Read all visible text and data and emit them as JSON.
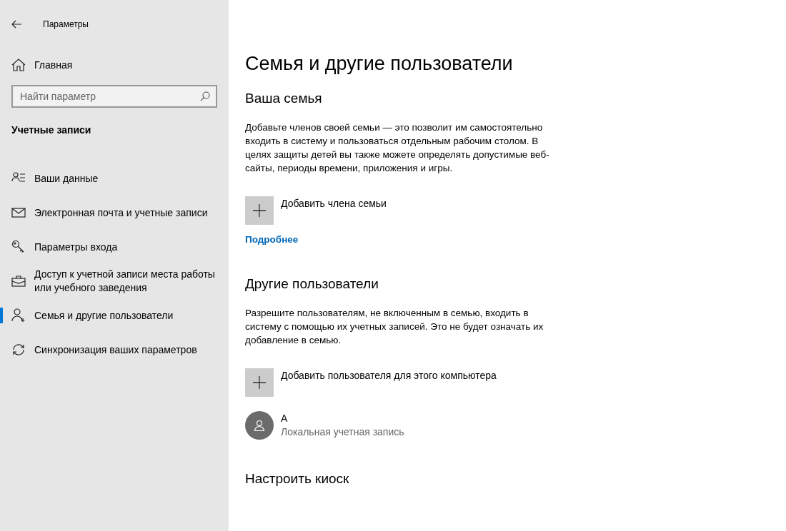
{
  "window": {
    "title": "Параметры"
  },
  "sidebar": {
    "home": "Главная",
    "search": {
      "placeholder": "Найти параметр"
    },
    "section": "Учетные записи",
    "items": [
      {
        "label": "Ваши данные",
        "selected": false
      },
      {
        "label": "Электронная почта и учетные записи",
        "selected": false
      },
      {
        "label": "Параметры входа",
        "selected": false
      },
      {
        "label": "Доступ к учетной записи места работы или учебного заведения",
        "selected": false
      },
      {
        "label": "Семья и другие пользователи",
        "selected": true
      },
      {
        "label": "Синхронизация ваших параметров",
        "selected": false
      }
    ]
  },
  "main": {
    "title": "Семья и другие пользователи",
    "sections": [
      {
        "heading": "Ваша семья",
        "description": "Добавьте членов своей семьи — это позволит им самостоятельно входить в систему и пользоваться отдельным рабочим столом. В целях защиты детей вы также можете определять допустимые веб-сайты, периоды времени, приложения и игры.",
        "add_button": "Добавить члена семьи",
        "link": "Подробнее"
      },
      {
        "heading": "Другие пользователи",
        "description": "Разрешите пользователям, не включенным в семью, входить в систему с помощью их учетных записей. Это не будет означать их добавление в семью.",
        "add_button": "Добавить пользователя для этого компьютера",
        "users": [
          {
            "name": "A",
            "subtitle": "Локальная учетная запись"
          }
        ]
      },
      {
        "heading": "Настроить киоск"
      }
    ]
  }
}
